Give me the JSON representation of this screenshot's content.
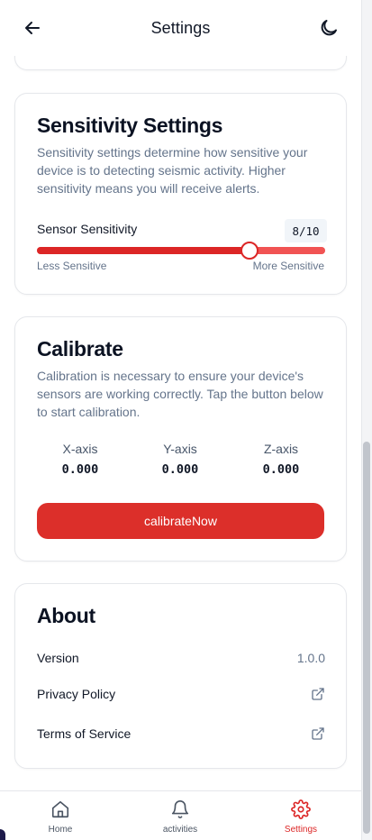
{
  "header": {
    "title": "Settings"
  },
  "sensitivity": {
    "title": "Sensitivity Settings",
    "description": "Sensitivity settings determine how sensitive your device is to detecting seismic activity. Higher sensitivity means you will receive alerts.",
    "slider_label": "Sensor Sensitivity",
    "value_badge": "8/10",
    "value": 8,
    "max": 10,
    "min_label": "Less Sensitive",
    "max_label": "More Sensitive"
  },
  "calibrate": {
    "title": "Calibrate",
    "description": "Calibration is necessary to ensure your device's sensors are working correctly. Tap the button below to start calibration.",
    "axes": [
      {
        "label": "X-axis",
        "value": "0.000"
      },
      {
        "label": "Y-axis",
        "value": "0.000"
      },
      {
        "label": "Z-axis",
        "value": "0.000"
      }
    ],
    "button_label": "calibrateNow"
  },
  "about": {
    "title": "About",
    "version_label": "Version",
    "version_value": "1.0.0",
    "privacy_label": "Privacy Policy",
    "terms_label": "Terms of Service"
  },
  "nav": {
    "items": [
      {
        "label": "Home",
        "icon": "home-icon"
      },
      {
        "label": "activities",
        "icon": "bell-icon"
      },
      {
        "label": "Settings",
        "icon": "gear-icon",
        "active": true
      }
    ]
  },
  "colors": {
    "accent": "#dc2626",
    "muted_text": "#64748b"
  }
}
